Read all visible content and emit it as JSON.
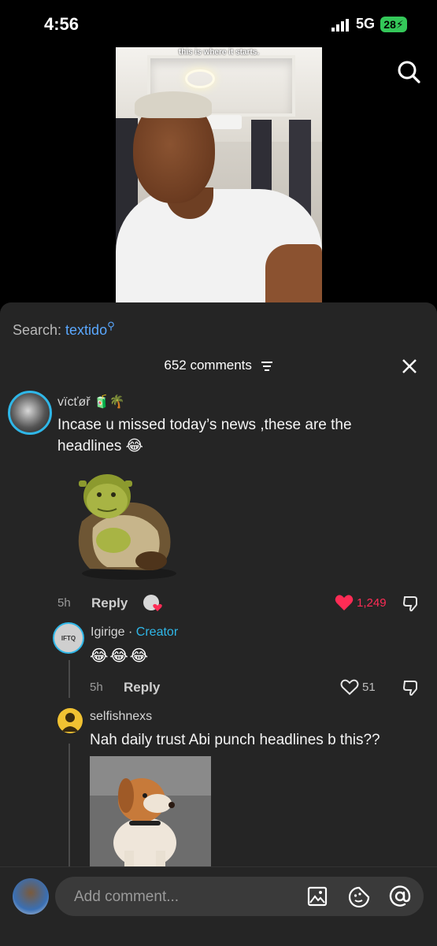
{
  "status": {
    "time": "4:56",
    "network": "5G",
    "battery": "28"
  },
  "video": {
    "caption": "this is where it starts."
  },
  "search": {
    "prefix": "Search: ",
    "term": "textido"
  },
  "comments_header": {
    "count_label": "652 comments"
  },
  "comments": [
    {
      "username": "vïcťøř 🧃🌴",
      "text": "Incase u missed today’s news ,these are the headlines 😂",
      "time": "5h",
      "reply_label": "Reply",
      "likes": "1,249",
      "liked": true
    }
  ],
  "replies": [
    {
      "username": "Igirige",
      "separator": " · ",
      "tag": "Creator",
      "avatar_text": "IFTQ",
      "text": "😂😂😂",
      "time": "5h",
      "reply_label": "Reply",
      "likes": "51"
    },
    {
      "username": "selfishnexs",
      "text": "Nah daily trust Abi punch headlines b this??"
    }
  ],
  "bottom": {
    "placeholder": "Add comment..."
  },
  "colors": {
    "accent_blue": "#5aa8ff",
    "like_red": "#fe2c55",
    "creator": "#2fb7e8",
    "battery": "#34c759"
  }
}
